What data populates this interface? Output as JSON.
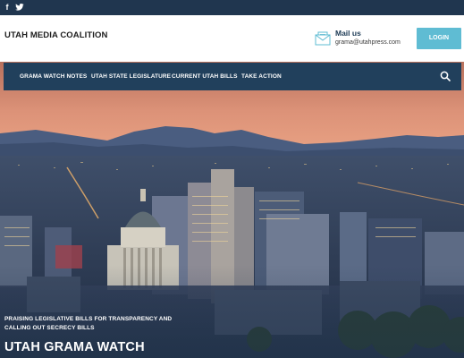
{
  "topbar": {
    "social": [
      {
        "name": "facebook-icon",
        "glyph": "f"
      },
      {
        "name": "twitter-icon",
        "glyph": "𝕥"
      }
    ]
  },
  "header": {
    "site_title": "UTAH MEDIA COALITION",
    "mail_title": "Mail us",
    "mail_email": "grama@utahpress.com",
    "login_label": "LOGIN"
  },
  "nav": {
    "items": [
      {
        "label": "GRAMA WATCH NOTES"
      },
      {
        "label": "UTAH STATE LEGISLATURE"
      },
      {
        "label": "CURRENT UTAH BILLS"
      },
      {
        "label": "TAKE ACTION"
      }
    ]
  },
  "hero": {
    "tagline": "PRAISING LEGISLATIVE BILLS FOR TRANSPARENCY AND CALLING OUT SECRECY BILLS",
    "title": "UTAH GRAMA WATCH"
  },
  "colors": {
    "topbar": "#20364f",
    "navbar": "#21405c",
    "login_button": "#5fbcd3",
    "sky_top": "#c97a62",
    "sky_bottom": "#e29a7a"
  }
}
